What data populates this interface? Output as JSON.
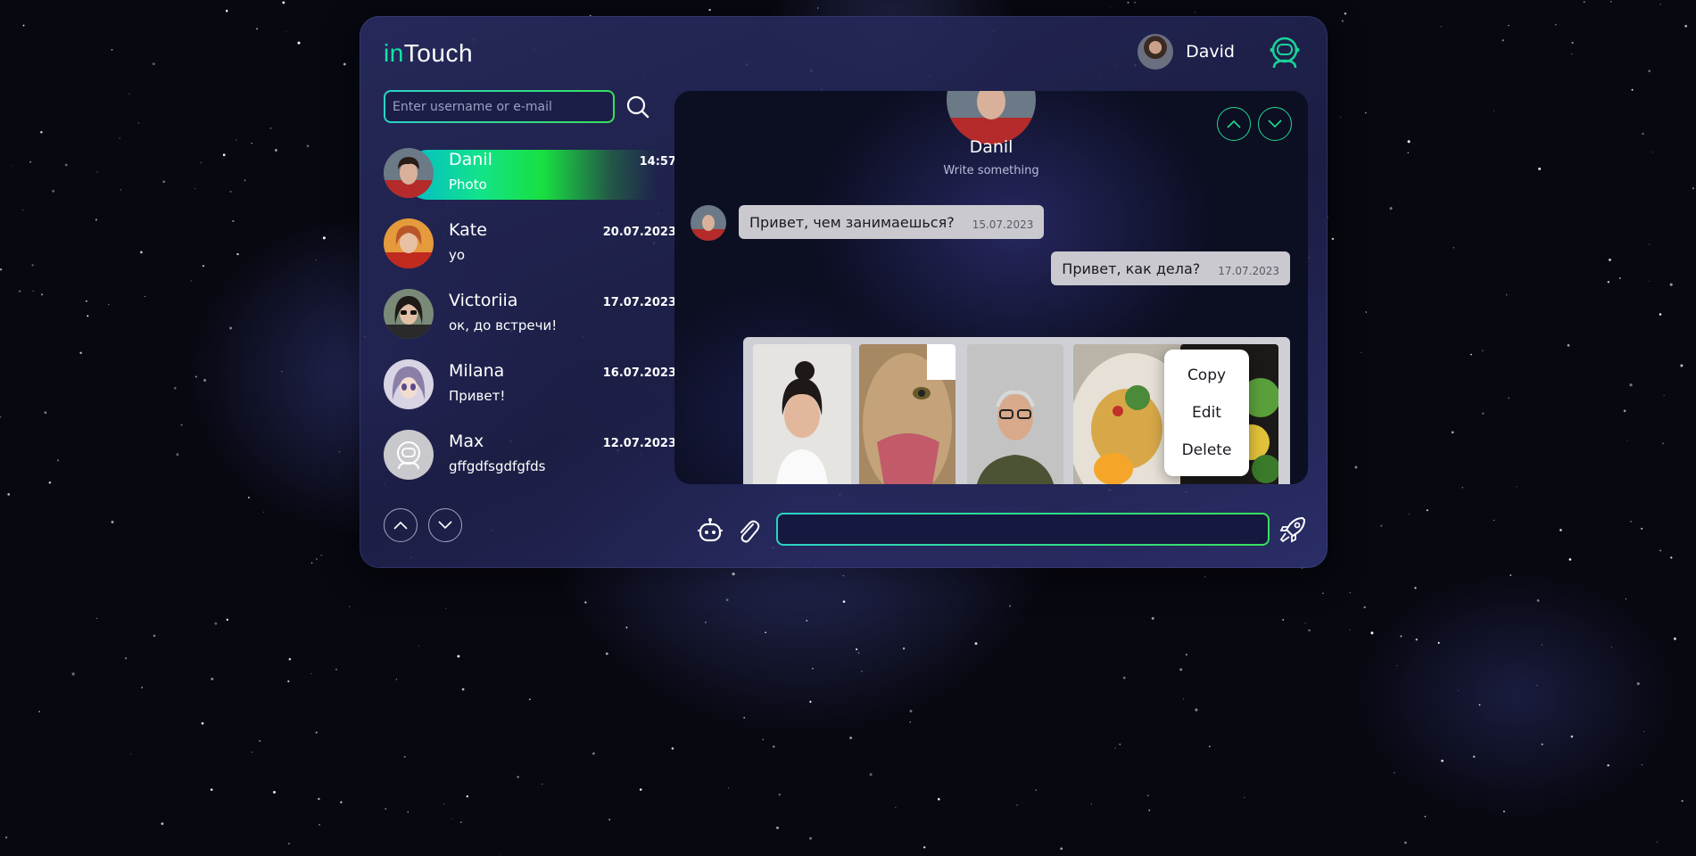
{
  "app": {
    "logo_in": "in",
    "logo_touch": "Touch"
  },
  "user": {
    "name": "David"
  },
  "search": {
    "placeholder": "Enter username or e-mail"
  },
  "contacts": [
    {
      "name": "Danil",
      "message": "Photo",
      "time": "14:57",
      "active": true
    },
    {
      "name": "Kate",
      "message": "yo",
      "time": "20.07.2023"
    },
    {
      "name": "Victoriia",
      "message": "ок, до встречи!",
      "time": "17.07.2023"
    },
    {
      "name": "Milana",
      "message": "Привет!",
      "time": "16.07.2023"
    },
    {
      "name": "Max",
      "message": "gffgdfsgdfgfds",
      "time": "12.07.2023"
    }
  ],
  "chat": {
    "name": "Danil",
    "status": "Write something",
    "messages": [
      {
        "text": "Привет, чем занимаешься?",
        "time": "15.07.2023",
        "incoming": true
      },
      {
        "text": "Привет, как дела?",
        "time": "17.07.2023",
        "incoming": false
      }
    ],
    "context_menu": [
      "Copy",
      "Edit",
      "Delete"
    ]
  },
  "composer": {
    "value": ""
  },
  "colors": {
    "accent_cyan": "#2ad3c8",
    "accent_green": "#36e25a",
    "logo_green": "#15e3a8",
    "bubble": "#c9c9cf"
  },
  "icons": [
    "search-icon",
    "chevron-up-icon",
    "chevron-down-icon",
    "robot-icon",
    "paperclip-icon",
    "rocket-icon",
    "astronaut-helmet-icon"
  ]
}
